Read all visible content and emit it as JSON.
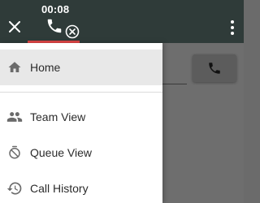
{
  "call": {
    "timer": "00:08"
  },
  "nav": {
    "items": [
      {
        "label": "Home",
        "icon": "home-icon",
        "active": true
      },
      {
        "label": "Team View",
        "icon": "people-icon",
        "active": false
      },
      {
        "label": "Queue View",
        "icon": "queue-timer-icon",
        "active": false
      },
      {
        "label": "Call History",
        "icon": "history-icon",
        "active": false
      }
    ]
  },
  "colors": {
    "topbar": "#2f3b39",
    "accent_underline": "#e04646",
    "drawer_active": "#e8e8e8",
    "overlay": "#6e6e6e"
  }
}
